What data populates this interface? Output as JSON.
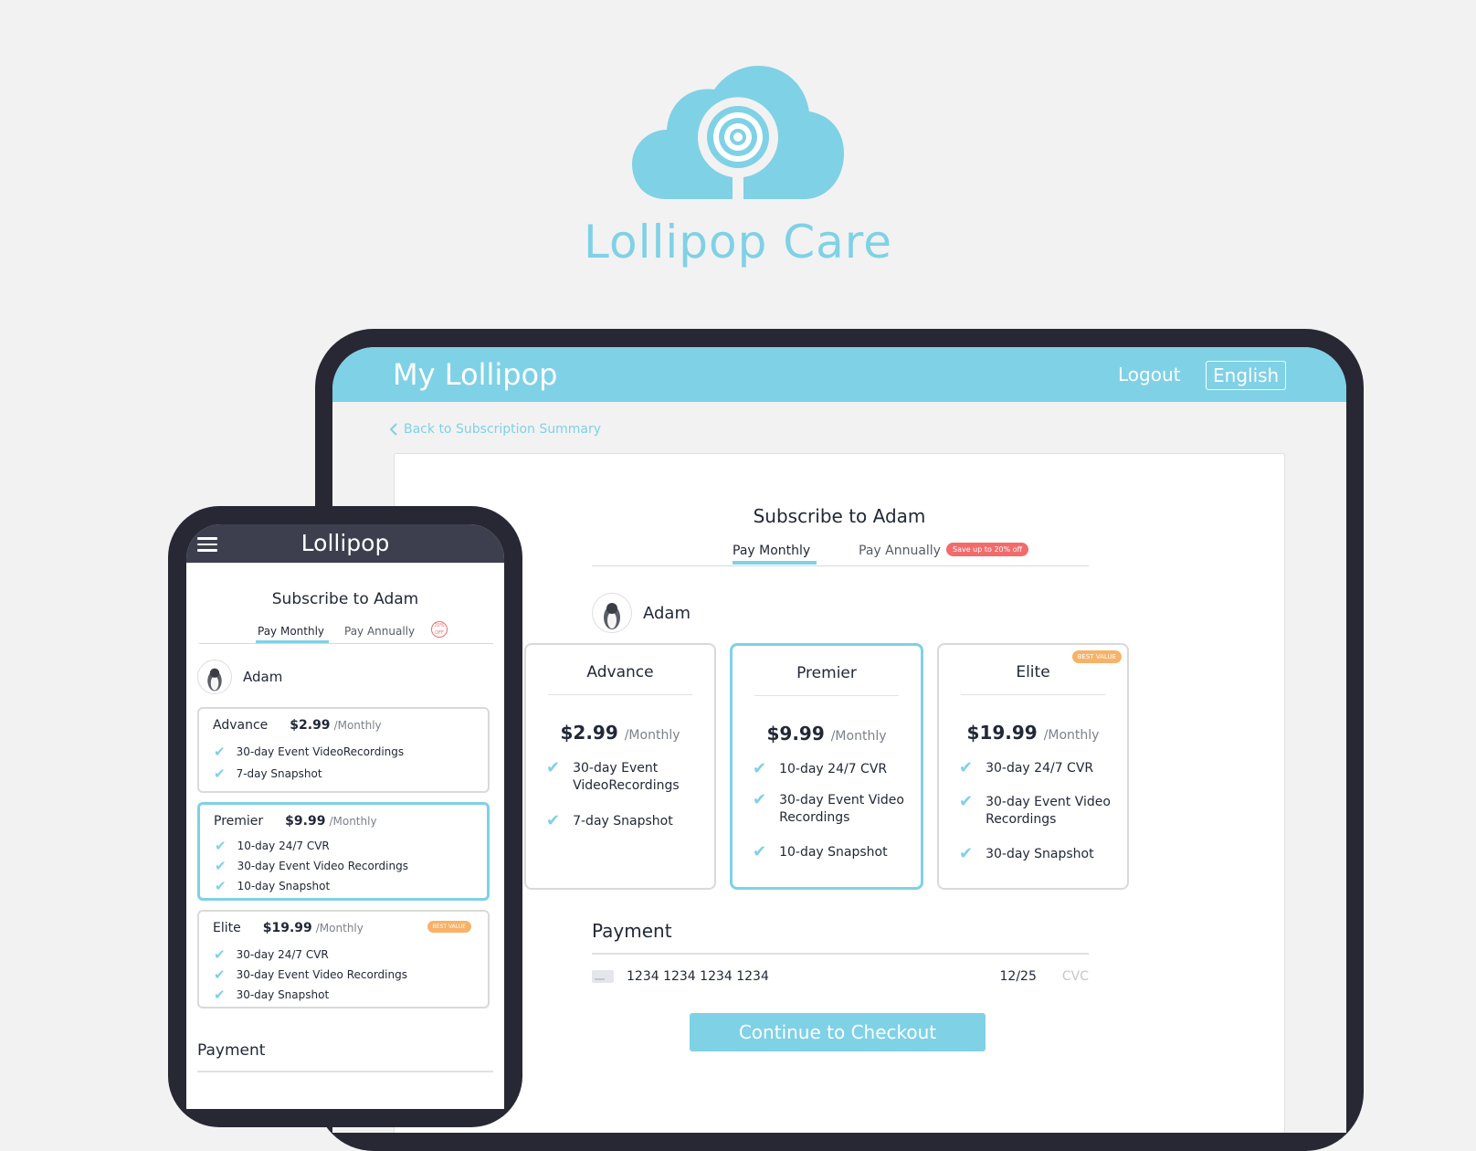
{
  "brand": {
    "name": "Lollipop Care",
    "color": "#7fd1e6"
  },
  "tablet": {
    "app_title": "My Lollipop",
    "logout": "Logout",
    "language": "English",
    "back": "Back to Subscription Summary",
    "heading": "Subscribe to Adam",
    "tabs": {
      "monthly": "Pay Monthly",
      "annually": "Pay Annually",
      "save_badge": "Save up to 20% off"
    },
    "user": "Adam",
    "plans": [
      {
        "name": "Advance",
        "price": "$2.99",
        "period": "/Monthly",
        "features": [
          "30-day Event VideoRecordings",
          "7-day Snapshot"
        ]
      },
      {
        "name": "Premier",
        "price": "$9.99",
        "period": "/Monthly",
        "features": [
          "10-day 24/7 CVR",
          "30-day Event Video Recordings",
          "10-day Snapshot"
        ]
      },
      {
        "name": "Elite",
        "price": "$19.99",
        "period": "/Monthly",
        "badge": "BEST VALUE",
        "features": [
          "30-day 24/7 CVR",
          "30-day Event Video Recordings",
          "30-day Snapshot"
        ]
      }
    ],
    "payment": {
      "title": "Payment",
      "card_number": "1234 1234 1234 1234",
      "expiry": "12/25",
      "cvc_placeholder": "CVC"
    },
    "checkout": "Continue to Checkout"
  },
  "phone": {
    "app_title": "Lollipop",
    "heading": "Subscribe to Adam",
    "tabs": {
      "monthly": "Pay Monthly",
      "annually": "Pay Annually",
      "badge": "20% OFF"
    },
    "user": "Adam",
    "plans": [
      {
        "name": "Advance",
        "price": "$2.99",
        "period": "/Monthly",
        "features": [
          "30-day Event VideoRecordings",
          "7-day Snapshot"
        ]
      },
      {
        "name": "Premier",
        "price": "$9.99",
        "period": "/Monthly",
        "features": [
          "10-day 24/7 CVR",
          "30-day Event Video Recordings",
          "10-day Snapshot"
        ]
      },
      {
        "name": "Elite",
        "price": "$19.99",
        "period": "/Monthly",
        "badge": "BEST VALUE",
        "features": [
          "30-day 24/7 CVR",
          "30-day Event Video Recordings",
          "30-day Snapshot"
        ]
      }
    ],
    "payment_title": "Payment"
  },
  "icons": {
    "check": "check-icon",
    "back": "chevron-left-icon",
    "menu": "hamburger-menu-icon",
    "card": "credit-card-icon"
  }
}
